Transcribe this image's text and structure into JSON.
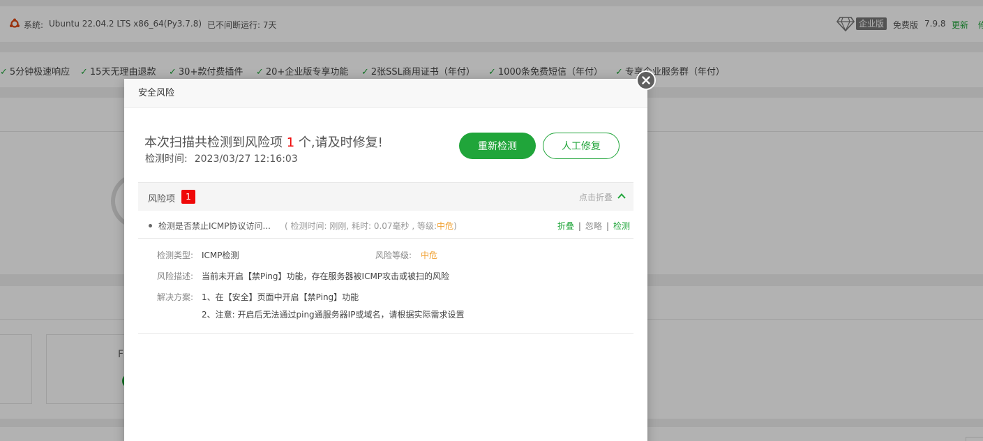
{
  "topbar": {
    "system_label": "系统:",
    "system_value": "Ubuntu 22.04.2 LTS x86_64(Py3.7.8)",
    "uptime": "已不间断运行: 7天",
    "enterprise_badge": "企业版",
    "free_label": "免费版",
    "version": "7.9.8",
    "update_link": "更新",
    "repair_link": "修"
  },
  "benefits": [
    "5分钟极速响应",
    "15天无理由退款",
    "30+款付费插件",
    "20+企业版专享功能",
    "2张SSL商用证书（年付）",
    "1000条免费短信（年付）",
    "专享企业服务群（年付）"
  ],
  "background": {
    "card_label": "F"
  },
  "modal": {
    "title": "安全风险",
    "summary_prefix": "本次扫描共检测到风险项",
    "summary_count": "1",
    "summary_suffix": "个,请及时修复!",
    "scan_time_label": "检测时间:",
    "scan_time_value": "2023/03/27 12:16:03",
    "rescan_button": "重新检测",
    "manual_fix_button": "人工修复",
    "risk_section": {
      "title": "风险项",
      "count": "1",
      "collapse_label": "点击折叠"
    },
    "risk_item": {
      "name": "检测是否禁止ICMP协议访问...",
      "meta_prefix": "( 检测时间: 刚刚, 耗时: 0.07毫秒 , 等级:",
      "level": "中危",
      "meta_suffix": ")",
      "action_fold": "折叠",
      "action_ignore": "忽略",
      "action_check": "检测"
    },
    "details": {
      "type_label": "检测类型:",
      "type_value": "ICMP检测",
      "level_label": "风险等级:",
      "level_value": "中危",
      "desc_label": "风险描述:",
      "desc_value": "当前未开启【禁Ping】功能，存在服务器被ICMP攻击或被扫的风险",
      "solution_label": "解决方案:",
      "solution_1": "1、在【安全】页面中开启【禁Ping】功能",
      "solution_2": "2、注意: 开启后无法通过ping通服务器IP或域名，请根据实际需求设置"
    }
  },
  "colors": {
    "accent_green": "#20a53a",
    "risk_red": "#ef0808",
    "medium_orange": "#f0a030"
  }
}
